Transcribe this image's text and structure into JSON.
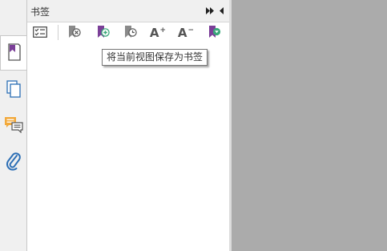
{
  "panel": {
    "title": "书签",
    "expand_label": "▸▸",
    "collapse_label": "◂"
  },
  "toolbar": {
    "buttons": [
      {
        "name": "expand-all",
        "icon": "checklist-icon"
      },
      {
        "name": "delete-bookmark",
        "icon": "bookmark-delete-icon"
      },
      {
        "name": "add-bookmark",
        "icon": "bookmark-add-icon"
      },
      {
        "name": "save-view-bookmark",
        "icon": "bookmark-view-icon"
      },
      {
        "name": "font-increase",
        "icon": "font-increase-icon",
        "label": "A",
        "sup": "+"
      },
      {
        "name": "font-decrease",
        "icon": "font-decrease-icon",
        "label": "A",
        "sup": "−"
      },
      {
        "name": "bookmark-options",
        "icon": "bookmark-options-icon"
      }
    ]
  },
  "tooltip": {
    "text": "将当前视图保存为书签"
  },
  "rail": {
    "tabs": [
      {
        "name": "bookmarks",
        "icon": "bookmark-icon",
        "active": true
      },
      {
        "name": "pages",
        "icon": "pages-icon",
        "active": false
      },
      {
        "name": "comments",
        "icon": "comments-icon",
        "active": false
      },
      {
        "name": "attachments",
        "icon": "paperclip-icon",
        "active": false
      }
    ]
  },
  "colors": {
    "accent_purple": "#7b3f98",
    "comment_orange": "#f2a93b",
    "icon_blue": "#2d6fb5",
    "bookmark_green": "#3aa87a",
    "document_gray": "#ababab"
  }
}
